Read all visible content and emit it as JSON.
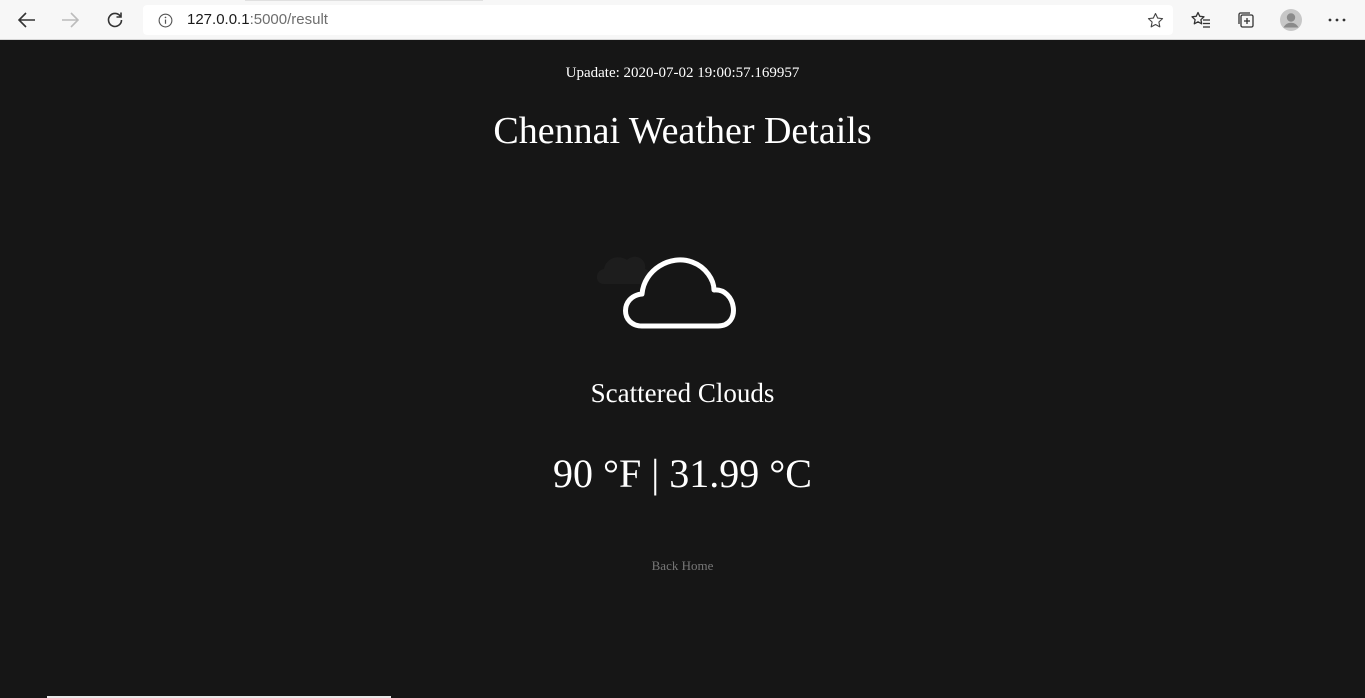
{
  "browser": {
    "url_host": "127.0.0.1",
    "url_path": ":5000/result"
  },
  "page": {
    "update_label": "Upadate:",
    "update_timestamp": "2020-07-02 19:00:57.169957",
    "title": "Chennai Weather Details",
    "weather_icon": "cloud-icon",
    "condition": "Scattered Clouds",
    "temperature": "90 °F | 31.99 °C",
    "back_link": "Back Home"
  },
  "colors": {
    "background": "#161616",
    "text": "#ffffff",
    "link": "#777777"
  }
}
